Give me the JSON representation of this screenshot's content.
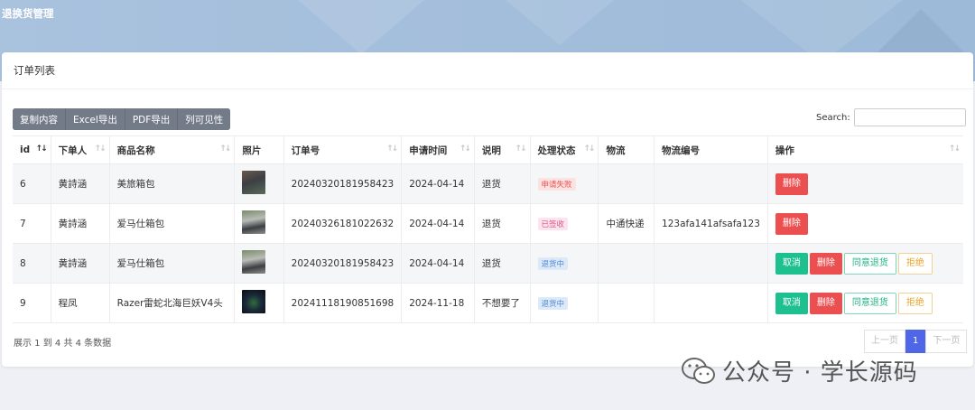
{
  "page": {
    "title": "退换货管理"
  },
  "card": {
    "title": "订单列表"
  },
  "toolbar": {
    "buttons": [
      "复制内容",
      "Excel导出",
      "PDF导出",
      "列可见性"
    ]
  },
  "search": {
    "label": "Search:",
    "value": ""
  },
  "table": {
    "headers": [
      "id",
      "下单人",
      "商品名称",
      "照片",
      "订单号",
      "申请时间",
      "说明",
      "处理状态",
      "物流",
      "物流编号",
      "操作"
    ],
    "rows": [
      {
        "id": "6",
        "user": "黄詩涵",
        "product": "美旅箱包",
        "order_no": "20240320181958423",
        "date": "2024-04-14",
        "note": "退货",
        "status": "申请失败",
        "status_color": "#e85454",
        "logistics": "",
        "tracking": "",
        "actions": [
          "删除"
        ]
      },
      {
        "id": "7",
        "user": "黄詩涵",
        "product": "爱马仕箱包",
        "order_no": "20240326181022632",
        "date": "2024-04-14",
        "note": "退货",
        "status": "已签收",
        "status_color": "#e0557d",
        "logistics": "中通快递",
        "tracking": "123afa141afsafa123",
        "actions": [
          "删除"
        ]
      },
      {
        "id": "8",
        "user": "黄詩涵",
        "product": "爱马仕箱包",
        "order_no": "20240320181958423",
        "date": "2024-04-14",
        "note": "退货",
        "status": "退货中",
        "status_color": "#4f8ad7",
        "logistics": "",
        "tracking": "",
        "actions": [
          "取消",
          "删除",
          "同意退货",
          "拒绝"
        ]
      },
      {
        "id": "9",
        "user": "程凤",
        "product": "Razer雷蛇北海巨妖V4头",
        "order_no": "20241118190851698",
        "date": "2024-11-18",
        "note": "不想要了",
        "status": "退货中",
        "status_color": "#4f8ad7",
        "logistics": "",
        "tracking": "",
        "actions": [
          "取消",
          "删除",
          "同意退货",
          "拒绝"
        ]
      }
    ]
  },
  "footer": {
    "info": "展示 1 到 4 共 4 条数据"
  },
  "pager": {
    "prev": "上一页",
    "current": "1",
    "next": "下一页"
  },
  "watermark": {
    "text": "公众号 · 学长源码"
  }
}
